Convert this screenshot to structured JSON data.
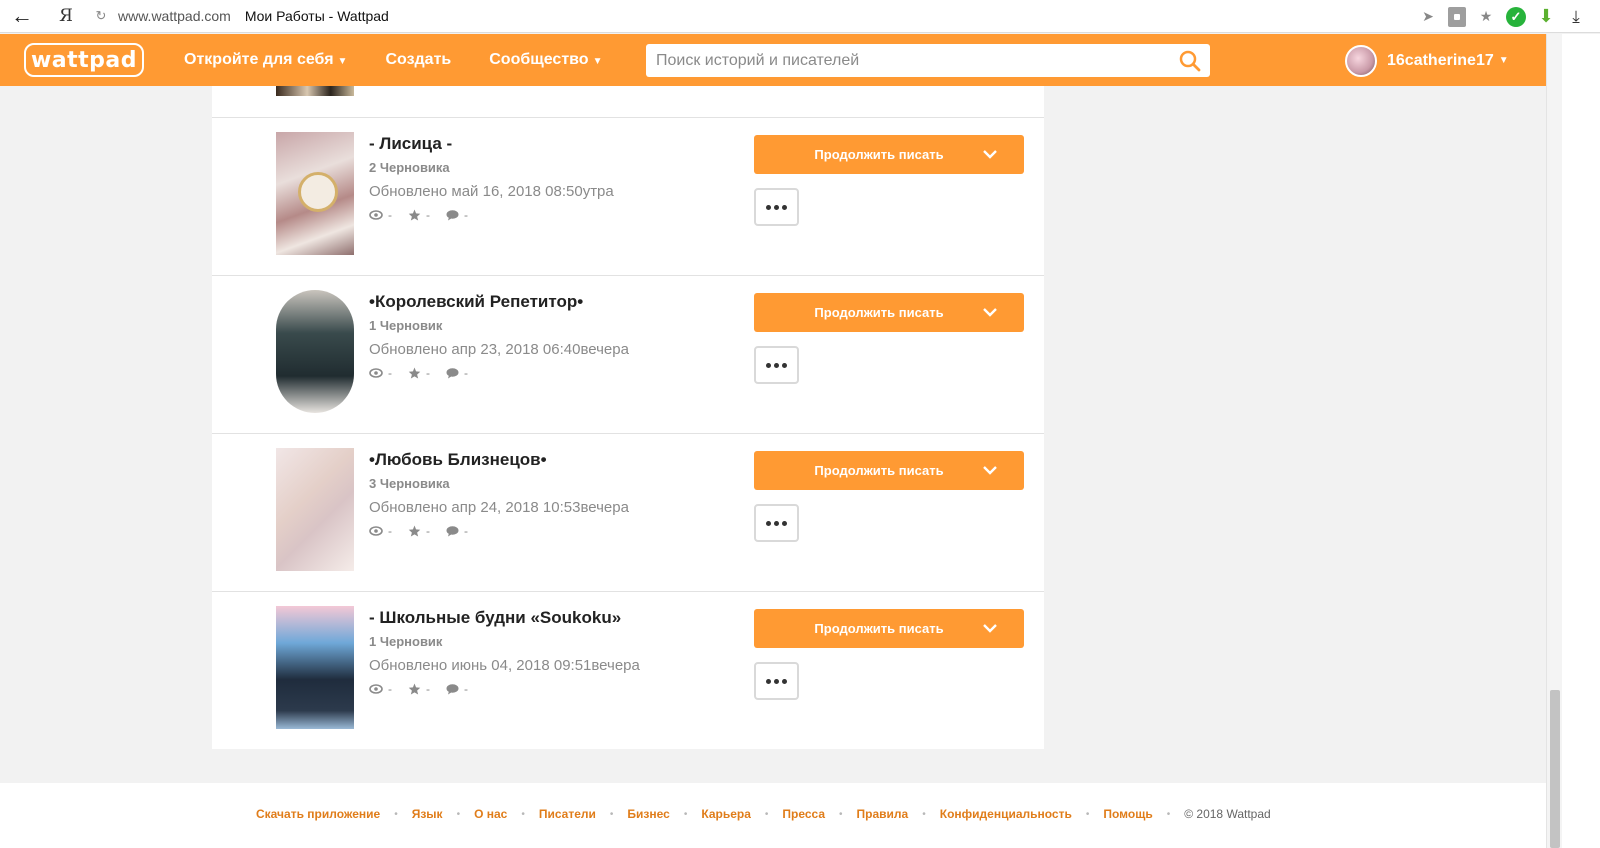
{
  "browser": {
    "url": "www.wattpad.com",
    "page_title": "Мои Работы - Wattpad",
    "back_icon": "←",
    "yandex_label": "Я",
    "reload_icon": "↻"
  },
  "nav": {
    "logo": "wattpad",
    "discover": "Откройте для себя",
    "create": "Создать",
    "community": "Сообщество",
    "search_placeholder": "Поиск историй и писателей",
    "username": "16catherine17",
    "accent": "#ff9a33"
  },
  "stories": [
    {
      "title": "- Лисица -",
      "drafts": "2 Черновика",
      "updated": "Обновлено май 16, 2018 08:50утра",
      "views": "-",
      "votes": "-",
      "comments": "-",
      "continue_label": "Продолжить писать"
    },
    {
      "title": "•Королевский Репетитор•",
      "drafts": "1 Черновик",
      "updated": "Обновлено апр 23, 2018 06:40вечера",
      "views": "-",
      "votes": "-",
      "comments": "-",
      "continue_label": "Продолжить писать"
    },
    {
      "title": "•Любовь Близнецов•",
      "drafts": "3 Черновика",
      "updated": "Обновлено апр 24, 2018 10:53вечера",
      "views": "-",
      "votes": "-",
      "comments": "-",
      "continue_label": "Продолжить писать"
    },
    {
      "title": "- Школьные будни «Soukoku»",
      "drafts": "1 Черновик",
      "updated": "Обновлено июнь 04, 2018 09:51вечера",
      "views": "-",
      "votes": "-",
      "comments": "-",
      "continue_label": "Продолжить писать"
    }
  ],
  "footer": {
    "links": [
      "Скачать приложение",
      "Язык",
      "О нас",
      "Писатели",
      "Бизнес",
      "Карьера",
      "Пресса",
      "Правила",
      "Конфиденциальность",
      "Помощь"
    ],
    "copyright": "© 2018 Wattpad",
    "link_color": "#e07d1a"
  }
}
